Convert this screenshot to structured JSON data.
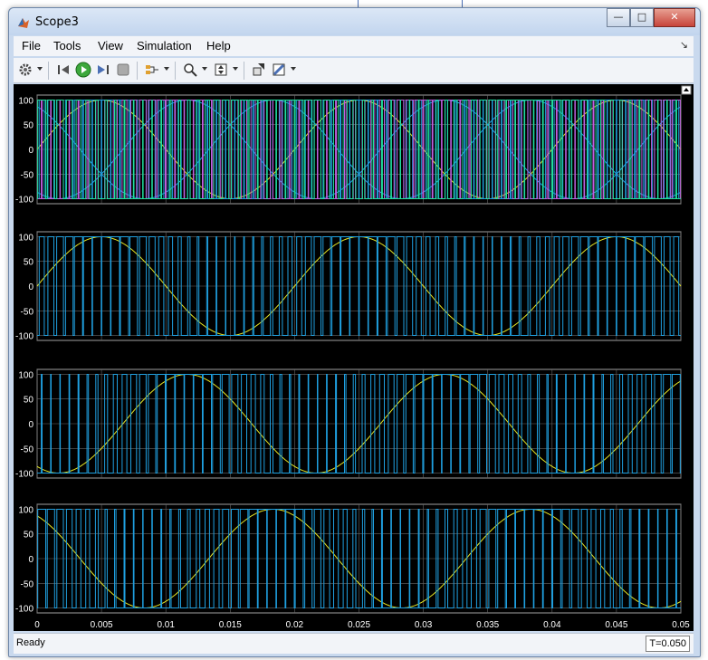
{
  "window": {
    "title": "Scope3",
    "buttons": {
      "minimize": "—",
      "maximize": "□",
      "close": "✕"
    }
  },
  "menu": {
    "items": [
      "File",
      "Tools",
      "View",
      "Simulation",
      "Help"
    ]
  },
  "toolbar": {
    "icons": [
      "gear-icon",
      "step-back-icon",
      "run-icon",
      "step-forward-icon",
      "stop-icon",
      "signal-selector-icon",
      "zoom-icon",
      "scale-axes-icon",
      "highlight-block-icon",
      "style-icon"
    ]
  },
  "colors": {
    "background": "#000000",
    "axes_bg": "#000000",
    "grid": "#686868",
    "tick_text": "#ffffff",
    "carrier": "#1fa0e0",
    "modulating": "#e6e624",
    "phase_b": "#c060e0",
    "phase_c": "#20e0a0"
  },
  "chart_data": [
    {
      "type": "line",
      "series": [
        {
          "kind": "sine",
          "amplitude": 100,
          "frequency_hz": 50,
          "phase_deg": 0,
          "color": "#e6e624"
        },
        {
          "kind": "sine",
          "amplitude": 100,
          "frequency_hz": 50,
          "phase_deg": -120,
          "color": "#1fa0e0"
        },
        {
          "kind": "sine",
          "amplitude": 100,
          "frequency_hz": 50,
          "phase_deg": 120,
          "color": "#1fa0e0"
        },
        {
          "kind": "pwm",
          "amplitude": 100,
          "pulses": 70,
          "color": "#1fa0e0"
        },
        {
          "kind": "pwm",
          "amplitude": 100,
          "pulses": 70,
          "color": "#c060e0"
        },
        {
          "kind": "pwm",
          "amplitude": 100,
          "pulses": 70,
          "color": "#20e0a0"
        }
      ],
      "xlim": [
        0,
        0.05
      ],
      "ylim": [
        -110,
        110
      ],
      "yticks": [
        100,
        50,
        0,
        -50,
        -100
      ],
      "grid": true
    },
    {
      "type": "line",
      "series": [
        {
          "kind": "sine",
          "amplitude": 100,
          "frequency_hz": 50,
          "phase_deg": 0,
          "color": "#e6e624"
        },
        {
          "kind": "pwm",
          "amplitude": 100,
          "pulses": 70,
          "color": "#1fa0e0"
        }
      ],
      "xlim": [
        0,
        0.05
      ],
      "ylim": [
        -110,
        110
      ],
      "yticks": [
        100,
        50,
        0,
        -50,
        -100
      ],
      "grid": true
    },
    {
      "type": "line",
      "series": [
        {
          "kind": "sine",
          "amplitude": 100,
          "frequency_hz": 50,
          "phase_deg": -120,
          "color": "#e6e624"
        },
        {
          "kind": "pwm",
          "amplitude": 100,
          "pulses": 70,
          "color": "#1fa0e0"
        }
      ],
      "xlim": [
        0,
        0.05
      ],
      "ylim": [
        -110,
        110
      ],
      "yticks": [
        100,
        50,
        0,
        -50,
        -100
      ],
      "grid": true
    },
    {
      "type": "line",
      "series": [
        {
          "kind": "sine",
          "amplitude": 100,
          "frequency_hz": 50,
          "phase_deg": 120,
          "color": "#e6e624"
        },
        {
          "kind": "pwm",
          "amplitude": 100,
          "pulses": 70,
          "color": "#1fa0e0"
        }
      ],
      "xlim": [
        0,
        0.05
      ],
      "ylim": [
        -110,
        110
      ],
      "yticks": [
        100,
        50,
        0,
        -50,
        -100
      ],
      "xticks": [
        "0",
        "0.005",
        "0.01",
        "0.015",
        "0.02",
        "0.025",
        "0.03",
        "0.035",
        "0.04",
        "0.045",
        "0.05"
      ],
      "grid": true
    }
  ],
  "status": {
    "left": "Ready",
    "right": "T=0.050"
  }
}
